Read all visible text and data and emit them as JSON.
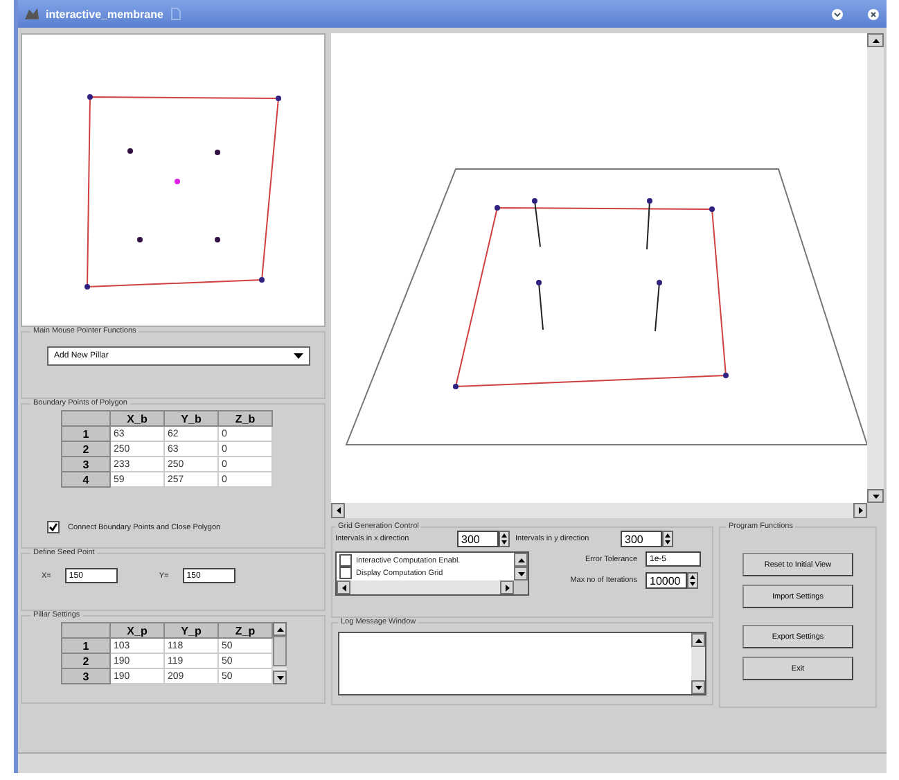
{
  "window": {
    "title": "interactive_membrane"
  },
  "mouse_functions": {
    "title": "Main Mouse Pointer Functions",
    "value": "Add New Pillar"
  },
  "boundary": {
    "title": "Boundary Points of Polygon",
    "columns": [
      "X_b",
      "Y_b",
      "Z_b"
    ],
    "rows": [
      {
        "label": "1",
        "cells": [
          "63",
          "62",
          "0"
        ]
      },
      {
        "label": "2",
        "cells": [
          "250",
          "63",
          "0"
        ]
      },
      {
        "label": "3",
        "cells": [
          "233",
          "250",
          "0"
        ]
      },
      {
        "label": "4",
        "cells": [
          "59",
          "257",
          "0"
        ]
      }
    ],
    "close_polygon": {
      "label": "Connect Boundary Points and Close Polygon",
      "checked": true
    }
  },
  "seed": {
    "title": "Define Seed Point",
    "fields": [
      {
        "label": "X=",
        "value": "150"
      },
      {
        "label": "Y=",
        "value": "150"
      }
    ]
  },
  "pillars": {
    "title": "Pillar Settings",
    "columns": [
      "X_p",
      "Y_p",
      "Z_p"
    ],
    "rows": [
      {
        "label": "1",
        "cells": [
          "103",
          "118",
          "50"
        ]
      },
      {
        "label": "2",
        "cells": [
          "190",
          "119",
          "50"
        ]
      },
      {
        "label": "3",
        "cells": [
          "190",
          "209",
          "50"
        ]
      }
    ]
  },
  "grid_control": {
    "title": "Grid Generation Control",
    "x_intervals": {
      "label": "Intervals in x direction",
      "value": "300"
    },
    "y_intervals": {
      "label": "Intervals in y direction",
      "value": "300"
    },
    "options": [
      {
        "label": "Interactive Computation Enabl.",
        "checked": false
      },
      {
        "label": "Display Computation Grid",
        "checked": false
      }
    ],
    "error_tolerance": {
      "label": "Error Tolerance",
      "value": "1e-5"
    },
    "max_iterations": {
      "label": "Max no of Iterations",
      "value": "10000"
    }
  },
  "log": {
    "title": "Log Message Window"
  },
  "program_functions": {
    "title": "Program Functions",
    "buttons": [
      "Reset to Initial View",
      "Import Settings",
      "Export Settings",
      "Exit"
    ]
  }
}
